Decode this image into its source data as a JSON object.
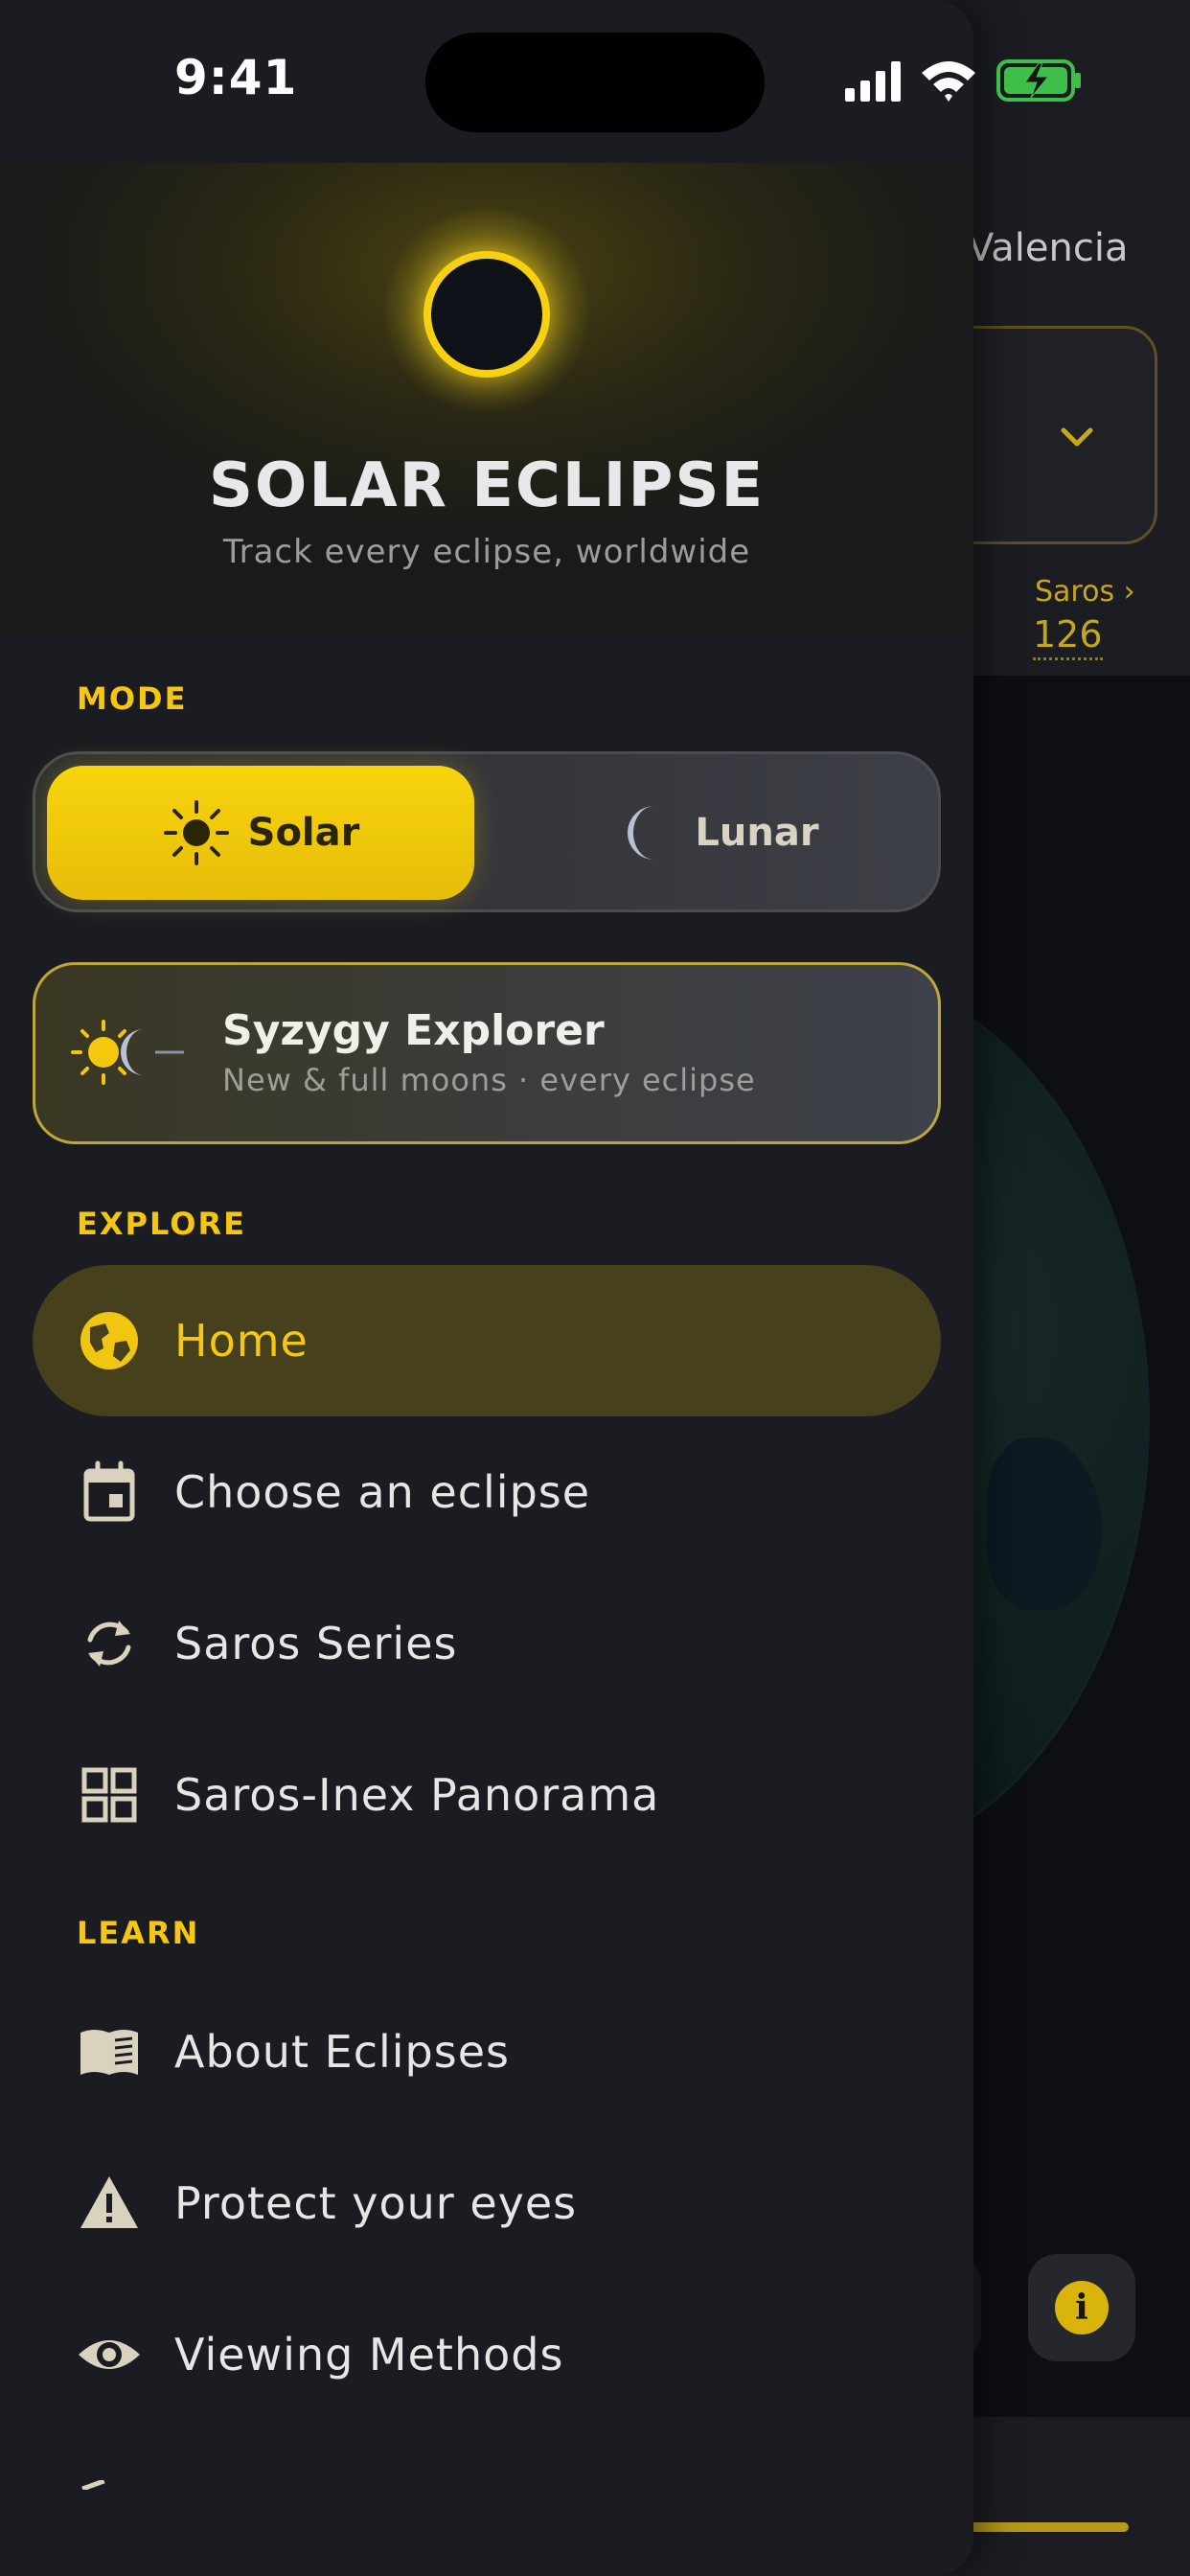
{
  "status_bar": {
    "time": "9:41"
  },
  "background_app": {
    "location": "Valencia",
    "saros_label": "Saros ›",
    "saros_number": "126",
    "info_icon_glyph": "i"
  },
  "hero": {
    "title": "SOLAR ECLIPSE",
    "subtitle": "Track every eclipse, worldwide"
  },
  "mode": {
    "section_label": "MODE",
    "options": [
      {
        "label": "Solar",
        "icon": "sun-icon",
        "selected": true
      },
      {
        "label": "Lunar",
        "icon": "moon-icon",
        "selected": false
      }
    ]
  },
  "explorer": {
    "title": "Syzygy Explorer",
    "subtitle": "New & full moons · every eclipse",
    "icon": "sun-moon-icon"
  },
  "explore": {
    "section_label": "EXPLORE",
    "items": [
      {
        "label": "Home",
        "icon": "globe-icon",
        "active": true
      },
      {
        "label": "Choose an eclipse",
        "icon": "calendar-icon",
        "active": false
      },
      {
        "label": "Saros Series",
        "icon": "cycle-icon",
        "active": false
      },
      {
        "label": "Saros-Inex Panorama",
        "icon": "grid-icon",
        "active": false
      }
    ]
  },
  "learn": {
    "section_label": "LEARN",
    "items": [
      {
        "label": "About Eclipses",
        "icon": "book-icon"
      },
      {
        "label": "Protect your eyes",
        "icon": "warning-icon"
      },
      {
        "label": "Viewing Methods",
        "icon": "eye-icon"
      }
    ]
  },
  "colors": {
    "accent": "#f5c710",
    "drawer_bg": "#1b1c21",
    "active_item_bg": "#46401d",
    "solar_button": "#f8d40c"
  }
}
